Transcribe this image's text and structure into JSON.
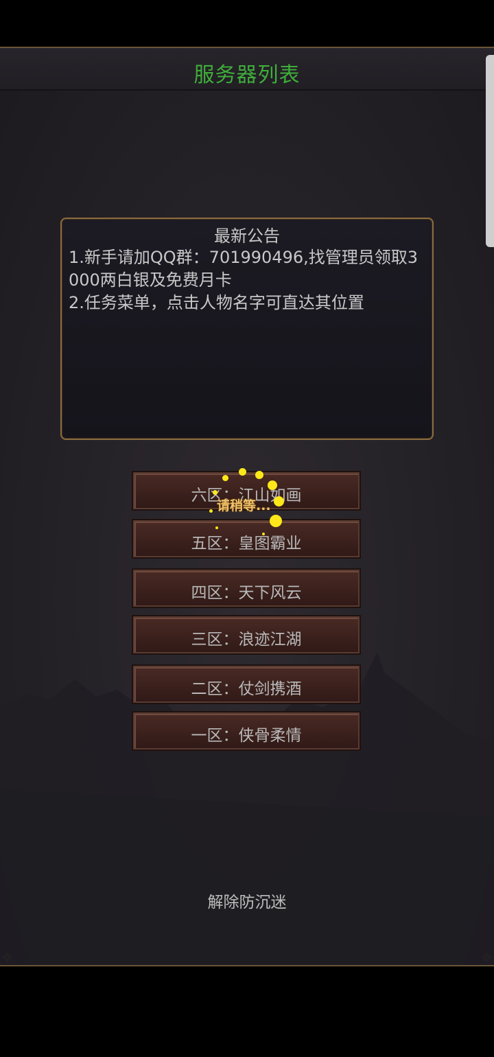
{
  "header": {
    "title": "服务器列表"
  },
  "notice": {
    "title": "最新公告",
    "lines": [
      "1.新手请加QQ群：701990496,找管理员领取3000两白银及免费月卡",
      "2.任务菜单，点击人物名字可直达其位置"
    ]
  },
  "servers": [
    {
      "label": "六区：江山如画"
    },
    {
      "label": "五区：皇图霸业"
    },
    {
      "label": "四区：天下风云"
    },
    {
      "label": "三区：浪迹江湖"
    },
    {
      "label": "二区：仗剑携酒"
    },
    {
      "label": "一区：侠骨柔情"
    }
  ],
  "loading": {
    "text": "请稍等..."
  },
  "footer": {
    "anti_addiction_label": "解除防沉迷"
  },
  "colors": {
    "title": "#3fae3a",
    "frame": "#8c6c3e",
    "loader": "#ffe81a"
  }
}
